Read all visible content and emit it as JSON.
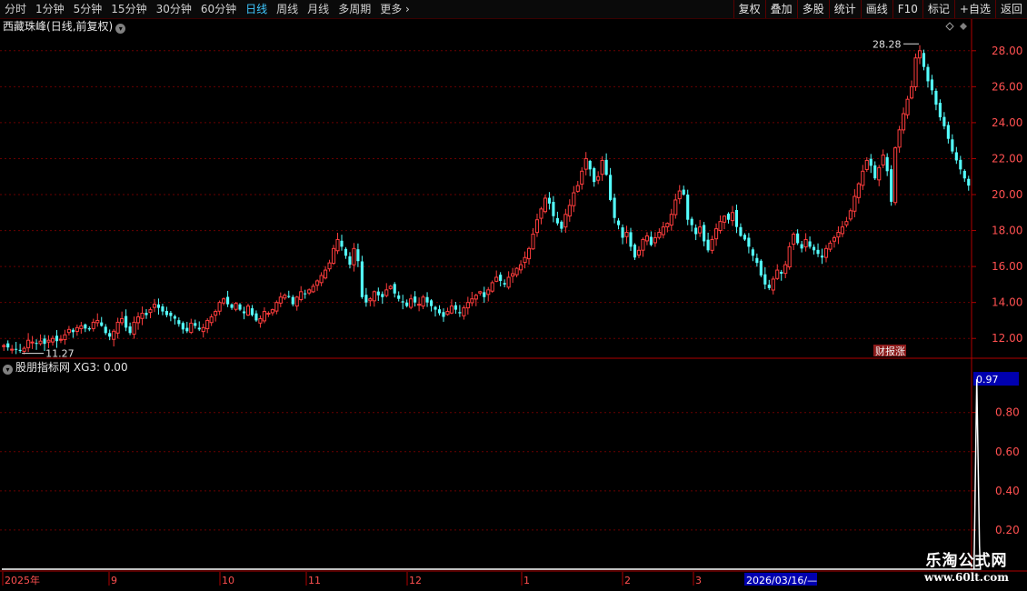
{
  "toolbar": {
    "periods": [
      "分时",
      "1分钟",
      "5分钟",
      "15分钟",
      "30分钟",
      "60分钟",
      "日线",
      "周线",
      "月线",
      "多周期",
      "更多"
    ],
    "active_period": "日线",
    "actions": [
      "复权",
      "叠加",
      "多股",
      "统计",
      "画线",
      "F10",
      "标记",
      "+自选",
      "返回"
    ]
  },
  "stock": {
    "name": "西藏珠峰",
    "mode": "(日线,前复权)"
  },
  "price_axis": {
    "labels": [
      "28.00",
      "26.00",
      "24.00",
      "22.00",
      "20.00",
      "18.00",
      "16.00",
      "14.00",
      "12.00"
    ]
  },
  "annotations": {
    "high": "28.28",
    "low": "11.27",
    "event_tag": "财报涨"
  },
  "indicator": {
    "name": "股朋指标网",
    "value_text": "XG3: 0.00",
    "current": "0.97",
    "axis_labels": [
      "0.80",
      "0.60",
      "0.40",
      "0.20"
    ]
  },
  "time_axis": {
    "labels": [
      "2025年",
      "9",
      "10",
      "11",
      "12",
      "1",
      "2",
      "3"
    ],
    "cursor": "2026/03/16/—"
  },
  "watermark": {
    "line1": "乐淘公式网",
    "line2": "www.60lt.com"
  },
  "colors": {
    "up": "#ff3d3d",
    "down": "#54ffff",
    "grid": "#7a0000",
    "active": "#3fc8ff"
  },
  "chart_data": {
    "type": "candlestick",
    "ylim": [
      11.0,
      28.9
    ],
    "closes": [
      11.6,
      11.5,
      11.4,
      11.4,
      11.3,
      11.45,
      11.9,
      11.8,
      11.7,
      11.85,
      11.7,
      11.9,
      12.0,
      11.85,
      11.95,
      12.2,
      12.5,
      12.35,
      12.6,
      12.7,
      12.55,
      12.5,
      12.9,
      13.0,
      12.7,
      12.3,
      12.1,
      12.4,
      12.9,
      13.1,
      12.6,
      12.3,
      12.9,
      13.2,
      13.4,
      13.3,
      13.6,
      13.9,
      13.7,
      13.5,
      13.3,
      13.25,
      13.1,
      12.8,
      12.5,
      12.4,
      12.85,
      12.7,
      12.5,
      12.6,
      13.0,
      13.2,
      13.5,
      14.0,
      14.2,
      13.9,
      13.7,
      13.95,
      13.6,
      13.4,
      13.8,
      13.3,
      13.0,
      13.1,
      13.5,
      13.4,
      13.6,
      14.0,
      14.3,
      14.4,
      14.3,
      13.9,
      14.3,
      14.6,
      14.5,
      14.7,
      14.9,
      15.2,
      15.5,
      15.8,
      16.2,
      17.0,
      17.5,
      17.1,
      16.6,
      16.1,
      17.0,
      16.3,
      14.3,
      14.0,
      14.2,
      14.6,
      14.4,
      14.3,
      14.7,
      14.9,
      14.5,
      14.2,
      14.0,
      13.8,
      14.2,
      14.0,
      13.9,
      14.3,
      14.0,
      13.8,
      13.6,
      13.4,
      13.2,
      13.5,
      13.8,
      13.6,
      13.4,
      13.7,
      14.0,
      14.2,
      14.4,
      14.6,
      14.3,
      14.7,
      15.1,
      15.4,
      15.2,
      15.0,
      15.4,
      15.6,
      15.9,
      16.1,
      16.5,
      17.0,
      17.8,
      18.6,
      19.2,
      19.8,
      19.5,
      18.8,
      18.4,
      18.1,
      18.9,
      19.4,
      20.1,
      20.5,
      21.3,
      22.0,
      21.4,
      20.7,
      21.0,
      21.9,
      21.1,
      19.7,
      18.7,
      18.3,
      17.6,
      17.9,
      17.1,
      16.5,
      16.9,
      17.5,
      17.7,
      17.2,
      17.6,
      17.9,
      18.2,
      18.4,
      18.9,
      19.7,
      20.2,
      20.0,
      18.6,
      18.3,
      17.8,
      18.2,
      17.4,
      16.9,
      17.5,
      18.1,
      18.5,
      18.8,
      18.6,
      19.0,
      18.2,
      17.7,
      17.5,
      17.1,
      16.6,
      16.2,
      15.5,
      15.0,
      14.8,
      15.3,
      15.8,
      15.6,
      16.1,
      17.1,
      17.8,
      17.3,
      17.0,
      17.5,
      17.1,
      16.9,
      16.7,
      16.5,
      17.0,
      17.3,
      17.6,
      17.9,
      18.2,
      18.5,
      19.1,
      19.9,
      20.6,
      21.3,
      21.9,
      21.6,
      20.9,
      21.5,
      22.2,
      21.3,
      19.6,
      22.6,
      23.6,
      24.5,
      25.3,
      26.0,
      27.6,
      28.0,
      27.1,
      26.3,
      25.8,
      25.0,
      24.3,
      23.8,
      23.1,
      22.4,
      21.9,
      21.4,
      20.9,
      20.5
    ],
    "indicator_spike_index": 239,
    "indicator_spike_value": 0.97
  }
}
